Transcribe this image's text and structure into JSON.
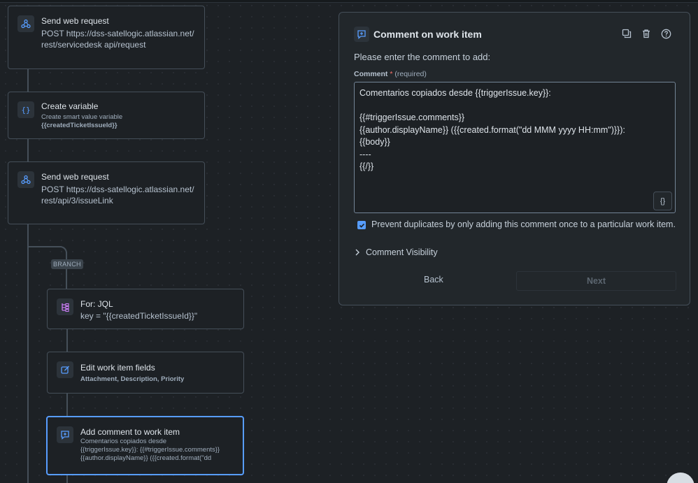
{
  "nodes": [
    {
      "title": "Send web request",
      "desc": "POST https://dss-satellogic.atlassian.net/rest/servicedesk api/request",
      "icon": "webhook-icon"
    },
    {
      "title": "Create variable",
      "desc1": "Create smart value variable",
      "desc2": "{{createdTicketIssueId}}",
      "icon": "braces-icon"
    },
    {
      "title": "Send web request",
      "desc": "POST https://dss-satellogic.atlassian.net/rest/api/3/issueLink",
      "icon": "webhook-icon"
    },
    {
      "title": "For: JQL",
      "desc": "key = \"{{createdTicketIssueId}}\"",
      "icon": "branch-icon"
    },
    {
      "title": "Edit work item fields",
      "desc": "Attachment, Description, Priority",
      "icon": "edit-icon"
    },
    {
      "title": "Add comment to work item",
      "desc": "Comentarios copiados desde {{triggerIssue.key}}: {{#triggerIssue.comments}} {{author.displayName}} ({{created.format(\"dd",
      "icon": "comment-icon"
    }
  ],
  "branch_label": "BRANCH",
  "panel": {
    "title": "Comment on work item",
    "prompt": "Please enter the comment to add:",
    "field_label": "Comment",
    "field_required_star": "*",
    "field_required_text": "(required)",
    "comment_lines": [
      "Comentarios copiados desde {{triggerIssue.key}}:",
      "",
      "{{#triggerIssue.comments}}",
      "{{author.displayName}} ({{created.format(\"dd MMM yyyy HH:mm\")}}):",
      "{{body}}",
      "----",
      "{{/}}"
    ],
    "smart_value_button": "{}",
    "checkbox_label": "Prevent duplicates by only adding this comment once to a particular work item.",
    "checkbox_checked": true,
    "visibility_label": "Comment Visibility",
    "back_label": "Back",
    "next_label": "Next"
  },
  "colors": {
    "accent": "#579dff",
    "background": "#1d2125",
    "panel": "#22272b"
  }
}
